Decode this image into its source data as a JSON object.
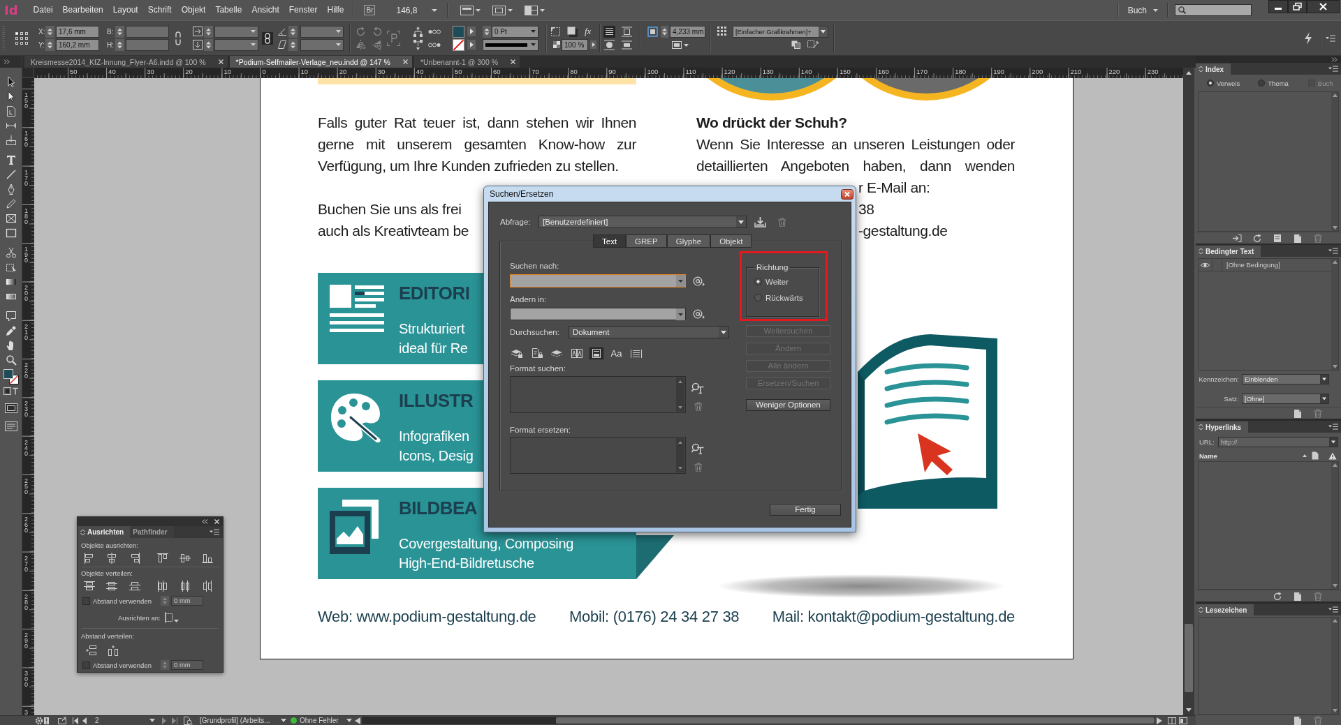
{
  "menu_bar": {
    "logo": "Id",
    "items": [
      "Datei",
      "Bearbeiten",
      "Layout",
      "Schrift",
      "Objekt",
      "Tabelle",
      "Ansicht",
      "Fenster",
      "Hilfe"
    ],
    "bridge": "Br",
    "zoom": "146,8",
    "workspace": "Buch"
  },
  "control_panel": {
    "x_label": "X:",
    "x_value": "17,6 mm",
    "y_label": "Y:",
    "y_value": "160,2 mm",
    "width_label": "B:",
    "height_label": "H:",
    "stroke_weight": "0 Pt",
    "effects": "fx",
    "opacity": "100 %",
    "text_wrap": [
      {
        "selected": true
      },
      {
        "selected": false
      },
      {
        "selected": false
      },
      {
        "selected": false
      }
    ],
    "offset": "4,233 mm",
    "object_style": "[Einfacher Grafikrahmen]+"
  },
  "document_tabs": [
    {
      "label": "Kreismesse2014_KfZ-Innung_Flyer-A6.indd @ 100 %",
      "selected": false
    },
    {
      "label": "*Podium-Selfmailer-Verlage_neu.indd @ 147 %",
      "selected": true
    },
    {
      "label": "*Unbenannt-1 @ 300 %",
      "selected": false
    }
  ],
  "rulers": {
    "horizontal": [
      "50",
      "40",
      "30",
      "20",
      "10",
      "0",
      "10",
      "20",
      "30",
      "40",
      "50",
      "60",
      "70",
      "80",
      "90",
      "100",
      "110",
      "120",
      "130",
      "140",
      "150",
      "160",
      "170",
      "180",
      "190",
      "200",
      "210",
      "220",
      "230"
    ],
    "vertical": [
      "150",
      "160",
      "170",
      "180",
      "190",
      "200",
      "210",
      "220",
      "230",
      "240",
      "250",
      "260",
      "270",
      "280",
      "290",
      "300",
      "3"
    ]
  },
  "document": {
    "left_paragraph": "Falls guter Rat teuer ist, dann stehen wir Ihnen gerne mit unserem gesamten Know-how zur Verfügung, um Ihre Kunden zufrieden zu stellen.",
    "left_fragments": [
      "Buchen Sie uns als frei",
      "auch als Kreativteam be"
    ],
    "right_heading": "Wo drückt der Schuh?",
    "right_paragraph": "Wenn Sie Interesse an unseren Leistungen oder detaillierten Angeboten haben, dann wenden",
    "right_fragments": [
      "r E-Mail an:",
      "38",
      "-gestaltung.de"
    ],
    "services": [
      {
        "title": "EDITORI",
        "lines": [
          "Strukturiert",
          "ideal für Re"
        ]
      },
      {
        "title": "ILLUSTR",
        "lines": [
          "Infografiken",
          "Icons, Desig"
        ]
      },
      {
        "title": "BILDBEA",
        "lines": [
          "Covergestaltung, Composing",
          "High-End-Bildretusche"
        ]
      }
    ],
    "contacts": [
      "Web: www.podium-gestaltung.de",
      "Mobil: (0176) 24 34 27 38",
      "Mail: kontakt@podium-gestaltung.de"
    ]
  },
  "find_dialog": {
    "title": "Suchen/Ersetzen",
    "query_label": "Abfrage:",
    "query": "[Benutzerdefiniert]",
    "tabs": [
      {
        "label": "Text",
        "selected": true
      },
      {
        "label": "GREP",
        "selected": false
      },
      {
        "label": "Glyphe",
        "selected": false
      },
      {
        "label": "Objekt",
        "selected": false
      }
    ],
    "fields": [
      {
        "label": "Suchen nach:",
        "focused": true
      },
      {
        "label": "Ändern in:",
        "focused": false
      }
    ],
    "scope_label": "Durchsuchen:",
    "scope": "Dokument",
    "options": [
      {
        "selected": false
      },
      {
        "selected": false
      },
      {
        "selected": false
      },
      {
        "selected": false
      },
      {
        "selected": true
      },
      {
        "label": "Aa",
        "selected": false
      },
      {
        "selected": false
      }
    ],
    "format_find_label": "Format suchen:",
    "format_change_label": "Format ersetzen:",
    "direction": {
      "title": "Richtung",
      "highlighted": true,
      "options": [
        {
          "label": "Weiter",
          "selected": true
        },
        {
          "label": "Rückwärts",
          "selected": false
        }
      ]
    },
    "buttons": [
      {
        "label": "Weitersuchen",
        "disabled": true
      },
      {
        "label": "Ändern",
        "disabled": true
      },
      {
        "label": "Alle ändern",
        "disabled": true
      },
      {
        "label": "Ersetzen/Suchen",
        "disabled": true
      },
      {
        "label": "Weniger Optionen",
        "disabled": false
      }
    ],
    "done_button": "Fertig"
  },
  "align_panel": {
    "tabs": [
      {
        "label": "Ausrichten",
        "selected": true
      },
      {
        "label": "Pathfinder",
        "selected": false
      }
    ],
    "align_objects_label": "Objekte ausrichten:",
    "distribute_objects_label": "Objekte verteilen:",
    "use_spacing_1": {
      "label": "Abstand verwenden",
      "checked": false,
      "value": "0 mm"
    },
    "align_to_label": "Ausrichten an:",
    "distribute_spacing_label": "Abstand verteilen:",
    "use_spacing_2": {
      "label": "Abstand verwenden",
      "checked": false,
      "value": "0 mm"
    }
  },
  "panels": {
    "index": {
      "title": "Index",
      "modes": [
        {
          "label": "Verweis",
          "selected": true
        },
        {
          "label": "Thema",
          "selected": false
        }
      ],
      "book": {
        "label": "Buch",
        "checked": false,
        "disabled": true
      }
    },
    "conditional_text": {
      "title": "Bedingter Text",
      "conditions": [
        {
          "name": "[Ohne Bedingung]",
          "visible": true
        }
      ],
      "indicators_label": "Kennzeichen:",
      "indicators": "Einblenden",
      "set_label": "Satz:",
      "set": "[Ohne]"
    },
    "hyperlinks": {
      "title": "Hyperlinks",
      "url": {
        "label": "URL:",
        "value": "http://",
        "disabled": true
      },
      "name_column": "Name"
    },
    "bookmarks": {
      "title": "Lesezeichen"
    }
  },
  "status_bar": {
    "page": "2",
    "preflight_profile": "[Grundprofil] (Arbeits...",
    "preflight_ok": true,
    "preflight_status": "Ohne Fehler"
  }
}
